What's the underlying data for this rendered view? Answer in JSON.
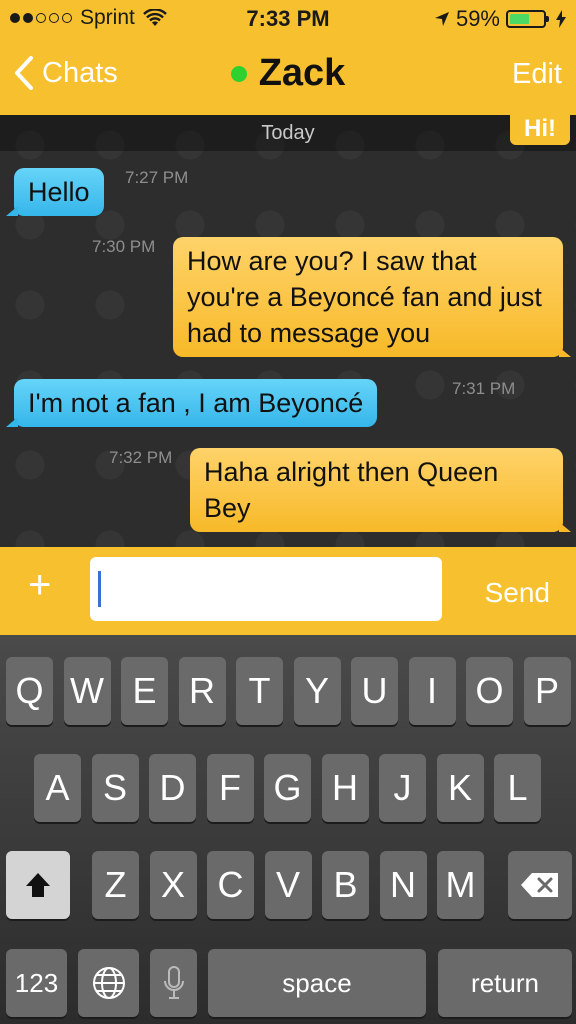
{
  "status_bar": {
    "carrier": "Sprint",
    "time": "7:33 PM",
    "battery_percent_label": "59%",
    "battery_level": 0.59,
    "signal_bars": 2,
    "icons": [
      "wifi-icon",
      "location-arrow-icon",
      "battery-icon",
      "charging-bolt-icon"
    ]
  },
  "nav": {
    "back_label": "Chats",
    "title": "Zack",
    "edit_label": "Edit",
    "online_color": "#2fd12f"
  },
  "chat": {
    "day_label": "Today",
    "peek_message": "Hi!",
    "messages": [
      {
        "direction": "incoming",
        "text": "Hello",
        "time": "7:27 PM"
      },
      {
        "direction": "outgoing",
        "text": "How are you? I saw that you're a Beyoncé fan and just had to message you",
        "time": "7:30 PM"
      },
      {
        "direction": "incoming",
        "text": "I'm not a fan , I am Beyoncé",
        "time": "7:31 PM"
      },
      {
        "direction": "outgoing",
        "text": "Haha alright then Queen Bey",
        "time": "7:32 PM"
      }
    ]
  },
  "composer": {
    "plus_label": "+",
    "input_value": "",
    "send_label": "Send"
  },
  "keyboard": {
    "row1": [
      "Q",
      "W",
      "E",
      "R",
      "T",
      "Y",
      "U",
      "I",
      "O",
      "P"
    ],
    "row2": [
      "A",
      "S",
      "D",
      "F",
      "G",
      "H",
      "J",
      "K",
      "L"
    ],
    "row3": [
      "Z",
      "X",
      "C",
      "V",
      "B",
      "N",
      "M"
    ],
    "numbers_label": "123",
    "space_label": "space",
    "return_label": "return"
  },
  "colors": {
    "accent_yellow": "#f7c02e",
    "incoming_blue": "#35b6ea",
    "background": "#2d2d2d"
  }
}
